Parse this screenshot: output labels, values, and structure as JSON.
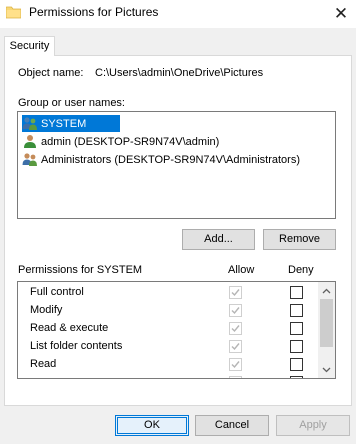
{
  "window": {
    "title": "Permissions for Pictures",
    "icon": "folder-icon",
    "close_glyph": "✕"
  },
  "tabs": [
    {
      "label": "Security",
      "active": true
    }
  ],
  "object": {
    "label": "Object name:",
    "value": "C:\\Users\\admin\\OneDrive\\Pictures"
  },
  "groups": {
    "label": "Group or user names:",
    "items": [
      {
        "label": "SYSTEM",
        "icon": "users-group-icon",
        "selected": true
      },
      {
        "label": "admin (DESKTOP-SR9N74V\\admin)",
        "icon": "user-icon",
        "selected": false
      },
      {
        "label": "Administrators (DESKTOP-SR9N74V\\Administrators)",
        "icon": "users-group-icon",
        "selected": false
      }
    ],
    "add_label": "Add...",
    "remove_label": "Remove"
  },
  "permissions": {
    "label": "Permissions for SYSTEM",
    "allow_header": "Allow",
    "deny_header": "Deny",
    "rows": [
      {
        "name": "Full control",
        "allow": true,
        "deny": false
      },
      {
        "name": "Modify",
        "allow": true,
        "deny": false
      },
      {
        "name": "Read & execute",
        "allow": true,
        "deny": false
      },
      {
        "name": "List folder contents",
        "allow": true,
        "deny": false
      },
      {
        "name": "Read",
        "allow": true,
        "deny": false
      },
      {
        "name": "",
        "allow": true,
        "deny": false
      }
    ]
  },
  "footer": {
    "ok_label": "OK",
    "cancel_label": "Cancel",
    "apply_label": "Apply"
  },
  "colors": {
    "selection": "#0078d7",
    "folder": "#f8d775"
  }
}
